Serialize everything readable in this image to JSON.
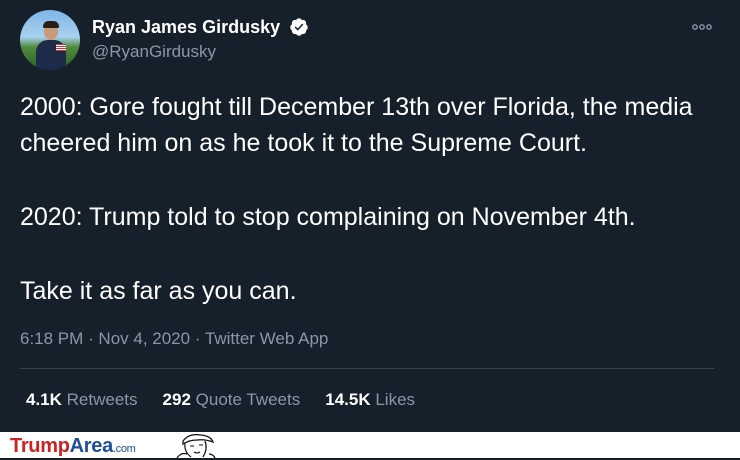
{
  "tweet": {
    "author_name": "Ryan James Girdusky",
    "handle": "@RyanGirdusky",
    "verified": true,
    "paragraphs": [
      "2000: Gore fought till December 13th over Florida, the media cheered him on as he took it to the Supreme Court.",
      "2020: Trump told to stop complaining on November 4th.",
      "Take it as far as you can."
    ],
    "timestamp": "6:18 PM · Nov 4, 2020 · Twitter Web App",
    "stats": [
      {
        "count": "4.1K",
        "label": "Retweets"
      },
      {
        "count": "292",
        "label": "Quote Tweets"
      },
      {
        "count": "14.5K",
        "label": "Likes"
      }
    ]
  },
  "watermark": {
    "part1": "Trump",
    "part2": "Area",
    "part3": ".com"
  },
  "colors": {
    "background": "#15202b",
    "secondary_text": "#8899a6",
    "verified": "#ffffff",
    "divider": "#38444d"
  },
  "icons": {
    "verified": "verified-badge-icon",
    "more": "more-options-icon"
  }
}
